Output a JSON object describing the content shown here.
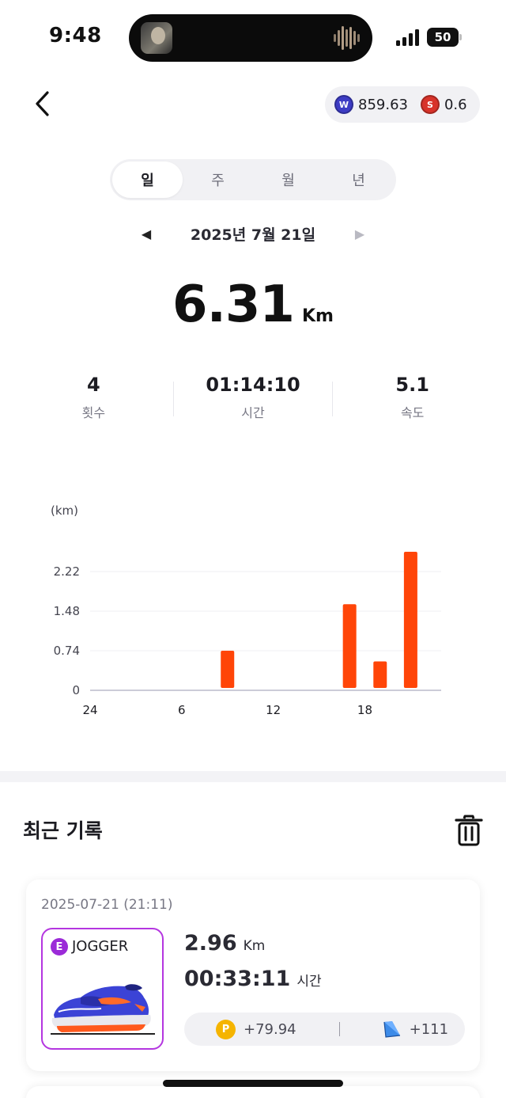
{
  "status_bar": {
    "time": "9:48",
    "battery": "50"
  },
  "header": {
    "wallet": {
      "coin_w_value": "859.63",
      "coin_s_value": "0.6",
      "coin_w_letter": "W",
      "coin_s_letter": "S"
    }
  },
  "period_tabs": [
    {
      "label": "일",
      "active": true
    },
    {
      "label": "주",
      "active": false
    },
    {
      "label": "월",
      "active": false
    },
    {
      "label": "년",
      "active": false
    }
  ],
  "date_nav": {
    "date": "2025년 7월 21일",
    "prev_icon": "◀",
    "next_icon": "▶"
  },
  "summary": {
    "distance": "6.31",
    "distance_unit": "Km"
  },
  "stats": [
    {
      "value": "4",
      "label": "횟수"
    },
    {
      "value": "01:14:10",
      "label": "시간"
    },
    {
      "value": "5.1",
      "label": "속도"
    }
  ],
  "chart_data": {
    "type": "bar",
    "ylabel": "(km)",
    "y_ticks": [
      "2.22",
      "1.48",
      "0.74",
      "0"
    ],
    "ylim": [
      0,
      2.96
    ],
    "x_ticks": [
      "24",
      "6",
      "12",
      "18"
    ],
    "x_tick_hours": [
      0,
      6,
      12,
      18
    ],
    "x_range": [
      0,
      23
    ],
    "grid": true,
    "bars": [
      {
        "hour": 9,
        "value": 0.74
      },
      {
        "hour": 17,
        "value": 1.61
      },
      {
        "hour": 19,
        "value": 0.54
      },
      {
        "hour": 21,
        "value": 2.59
      }
    ],
    "color": "#ff4508"
  },
  "recent": {
    "title": "최근 기록",
    "records": [
      {
        "datetime": "2025-07-21 (21:11)",
        "shoe_grade": "E",
        "shoe_name": "JOGGER",
        "distance": "2.96",
        "distance_unit": "Km",
        "time": "00:33:11",
        "time_unit": "시간",
        "point_letter": "P",
        "points": "+79.94",
        "tiles": "+111"
      }
    ]
  },
  "colors": {
    "accent": "#ff4508",
    "grade_epic": "#9b2ad8",
    "coin_w": "#3d3cc4",
    "coin_s": "#d8332a",
    "coin_p": "#f5b400"
  }
}
